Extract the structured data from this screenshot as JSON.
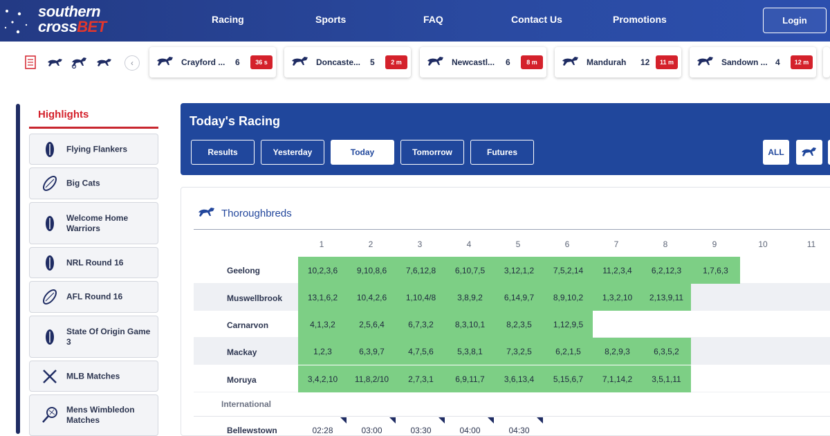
{
  "brand": {
    "line1": "southern",
    "line2a": "cross",
    "line2b": "BET",
    "accent": "#e3372c",
    "primary": "#20479c"
  },
  "nav": {
    "racing": "Racing",
    "sports": "Sports",
    "faq": "FAQ",
    "contact": "Contact Us",
    "promotions": "Promotions",
    "login": "Login"
  },
  "strip": {
    "icons": [
      "race-form-icon",
      "greyhound-icon",
      "harness-icon",
      "horse-icon"
    ],
    "prev": "‹",
    "races": [
      {
        "name": "Crayford ...",
        "number": "6",
        "time": "36 s",
        "icon": "greyhound-icon"
      },
      {
        "name": "Doncaste...",
        "number": "5",
        "time": "2 m",
        "icon": "horse-icon"
      },
      {
        "name": "Newcastl...",
        "number": "6",
        "time": "8 m",
        "icon": "greyhound-icon"
      },
      {
        "name": "Mandurah",
        "number": "12",
        "time": "11 m",
        "icon": "greyhound-icon"
      },
      {
        "name": "Sandown ...",
        "number": "4",
        "time": "12 m",
        "icon": "greyhound-icon"
      }
    ]
  },
  "sidebar": {
    "title": "Highlights",
    "items": [
      {
        "label": "Flying Flankers",
        "icon": "rugby-ball-icon"
      },
      {
        "label": "Big Cats",
        "icon": "afl-ball-icon"
      },
      {
        "label": "Welcome Home Warriors",
        "icon": "rugby-ball-icon"
      },
      {
        "label": "NRL Round 16",
        "icon": "rugby-ball-icon"
      },
      {
        "label": "AFL Round 16",
        "icon": "afl-ball-icon"
      },
      {
        "label": "State Of Origin Game 3",
        "icon": "rugby-ball-icon"
      },
      {
        "label": "MLB Matches",
        "icon": "baseball-bats-icon"
      },
      {
        "label": "Mens Wimbledon Matches",
        "icon": "tennis-racket-icon"
      }
    ]
  },
  "racing": {
    "title": "Today's Racing",
    "tabs": [
      "Results",
      "Yesterday",
      "Today",
      "Tomorrow",
      "Futures"
    ],
    "active_tab": "Today",
    "filters": {
      "all": "ALL"
    }
  },
  "table": {
    "section": "Thoroughbreds",
    "columns": [
      "1",
      "2",
      "3",
      "4",
      "5",
      "6",
      "7",
      "8",
      "9",
      "10",
      "11"
    ],
    "rows": [
      {
        "venue": "Geelong",
        "results": [
          "10,2,3,6",
          "9,10,8,6",
          "7,6,12,8",
          "6,10,7,5",
          "3,12,1,2",
          "7,5,2,14",
          "11,2,3,4",
          "6,2,12,3",
          "1,7,6,3"
        ]
      },
      {
        "venue": "Muswellbrook",
        "results": [
          "13,1,6,2",
          "10,4,2,6",
          "1,10,4/8",
          "3,8,9,2",
          "6,14,9,7",
          "8,9,10,2",
          "1,3,2,10",
          "2,13,9,11"
        ]
      },
      {
        "venue": "Carnarvon",
        "results": [
          "4,1,3,2",
          "2,5,6,4",
          "6,7,3,2",
          "8,3,10,1",
          "8,2,3,5",
          "1,12,9,5"
        ]
      },
      {
        "venue": "Mackay",
        "results": [
          "1,2,3",
          "6,3,9,7",
          "4,7,5,6",
          "5,3,8,1",
          "7,3,2,5",
          "6,2,1,5",
          "8,2,9,3",
          "6,3,5,2"
        ]
      },
      {
        "venue": "Moruya",
        "results": [
          "3,4,2,10",
          "11,8,2/10",
          "2,7,3,1",
          "6,9,11,7",
          "3,6,13,4",
          "5,15,6,7",
          "7,1,14,2",
          "3,5,1,11"
        ]
      }
    ],
    "international_label": "International",
    "international_rows": [
      {
        "venue": "Bellewstown",
        "times": [
          "02:28",
          "03:00",
          "03:30",
          "04:00",
          "04:30"
        ]
      }
    ],
    "result_color": "#7dcf85"
  }
}
